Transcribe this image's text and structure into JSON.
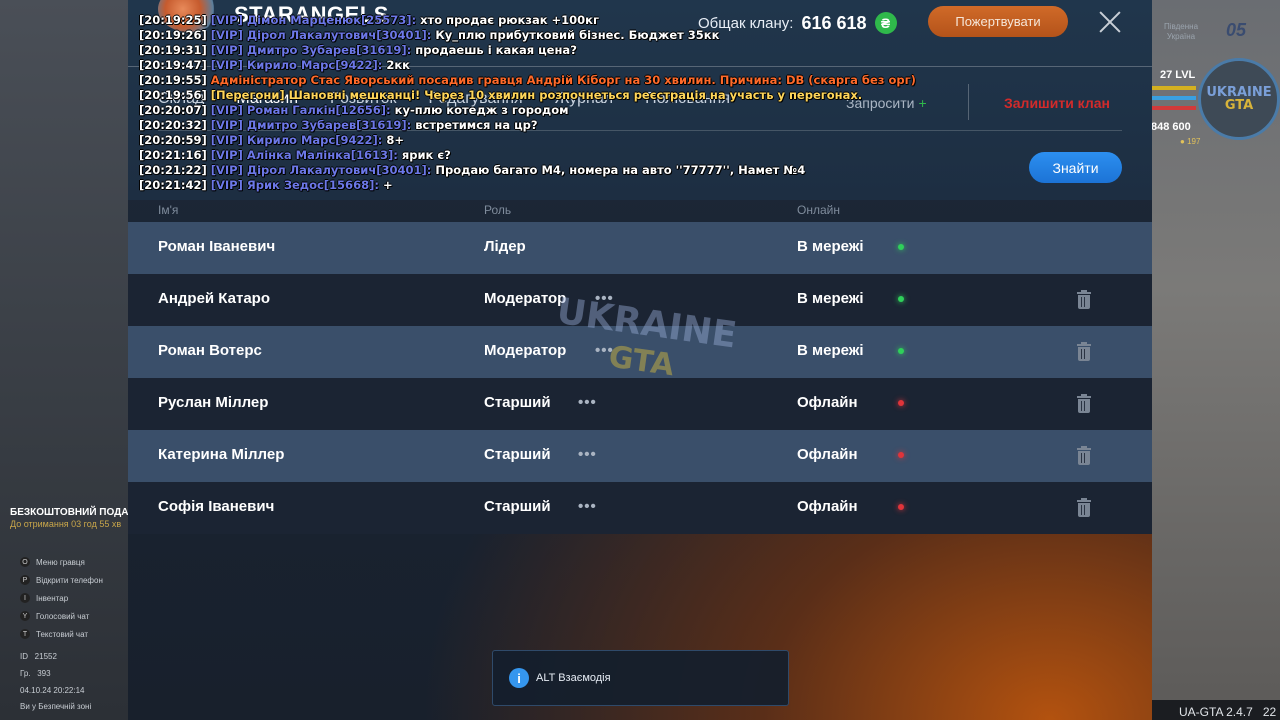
{
  "clan": {
    "name": "STARANGELS",
    "balance_label": "Общак клану:",
    "balance_value": "616 618",
    "currency_icon": "₴",
    "donate_label": "Пожертвувати",
    "tabs": [
      "Склад",
      "Магазин",
      "Розвиток",
      "Редагування",
      "Журнал",
      "Полювання"
    ],
    "invite_label": "Запросити",
    "leave_label": "Залишити клан",
    "find_label": "Знайти",
    "columns": {
      "name": "Ім'я",
      "role": "Роль",
      "status": "Онлайн"
    },
    "members": [
      {
        "name": "Роман Іваневич",
        "role": "Лідер",
        "status": "В мережі",
        "online": true
      },
      {
        "name": "Андрей Катаро",
        "role": "Модератор",
        "status": "В мережі",
        "online": true
      },
      {
        "name": "Роман Вотерс",
        "role": "Модератор",
        "status": "В мережі",
        "online": true
      },
      {
        "name": "Руслан Міллер",
        "role": "Старший",
        "status": "Офлайн",
        "online": false
      },
      {
        "name": "Катерина Міллер",
        "role": "Старший",
        "status": "Офлайн",
        "online": false
      },
      {
        "name": "Софія Іваневич",
        "role": "Старший",
        "status": "Офлайн",
        "online": false
      }
    ],
    "role_menu_glyph": "•••",
    "watermark_top": "UKRAINE",
    "watermark_bottom": "GTA"
  },
  "hint": {
    "icon": "i",
    "text": "ALT Взаємодія"
  },
  "chat": [
    {
      "time": "[20:19:25]",
      "tag": "[VIP] Дімон Марценюк[25573]:",
      "msg": "хто продає рюкзак +100кг",
      "kind": "vip"
    },
    {
      "time": "[20:19:26]",
      "tag": "[VIP] Дірол Лакалутович[30401]:",
      "msg": "Ку_плю прибутковий бізнес. Бюджет 35кк",
      "kind": "vip"
    },
    {
      "time": "[20:19:31]",
      "tag": "[VIP] Дмитро Зубарев[31619]:",
      "msg": "продаешь і какая цена?",
      "kind": "vip"
    },
    {
      "time": "[20:19:47]",
      "tag": "[VIP] Кирило Марс[9422]:",
      "msg": "2кк",
      "kind": "vip"
    },
    {
      "time": "[20:19:55]",
      "tag": "Адміністратор Стас Яворський посадив гравця Андрій Кіборг на 30 хвилин. Причина: DB (скарга без орг)",
      "msg": "",
      "kind": "admin"
    },
    {
      "time": "[20:19:56]",
      "tag": "[Перегони] Шановні мешканці! Через 10 хвилин розпочнеться реєстрація на участь у перегонах.",
      "msg": "",
      "kind": "event"
    },
    {
      "time": "[20:20:07]",
      "tag": "[VIP] Роман Галкін[12656]:",
      "msg": "ку-плю котедж з городом",
      "kind": "vip"
    },
    {
      "time": "[20:20:32]",
      "tag": "[VIP] Дмитро Зубарев[31619]:",
      "msg": "встретимся на цр?",
      "kind": "vip"
    },
    {
      "time": "[20:20:59]",
      "tag": "[VIP] Кирило Марс[9422]:",
      "msg": "8+",
      "kind": "vip"
    },
    {
      "time": "[20:21:16]",
      "tag": "[VIP] Алінка Малінка[1613]:",
      "msg": "ярик є?",
      "kind": "vip"
    },
    {
      "time": "[20:21:22]",
      "tag": "[VIP] Дірол Лакалутович[30401]:",
      "msg": "Продаю багато М4, номера на авто ''77777'', Намет №4",
      "kind": "vip"
    },
    {
      "time": "[20:21:42]",
      "tag": "[VIP] Ярик Зедос[15668]:",
      "msg": "+",
      "kind": "vip"
    }
  ],
  "hud": {
    "server_name": "Південна Україна",
    "server_number": "05",
    "level": "27 LVL",
    "money": "848 600",
    "coins": "197",
    "logo_top": "UKRAINE",
    "logo_bottom": "GTA",
    "version": "UA-GTA 2.4.7",
    "version_suffix": "22",
    "promo_title": "БЕЗКОШТОВНИЙ ПОДАРУНОК",
    "promo_sub": "До отримання 03 год 55 хв",
    "keys": [
      {
        "key": "O",
        "label": "Меню гравця"
      },
      {
        "key": "P",
        "label": "Відкрити телефон"
      },
      {
        "key": "I",
        "label": "Інвентар"
      },
      {
        "key": "Y",
        "label": "Голосовий чат"
      },
      {
        "key": "T",
        "label": "Текстовий чат"
      }
    ],
    "id_label": "ID",
    "id_value": "21552",
    "online_label": "Гр.",
    "online_value": "393",
    "datetime": "04.10.24 20:22:14",
    "zone": "Ви у Безпечній зоні"
  }
}
